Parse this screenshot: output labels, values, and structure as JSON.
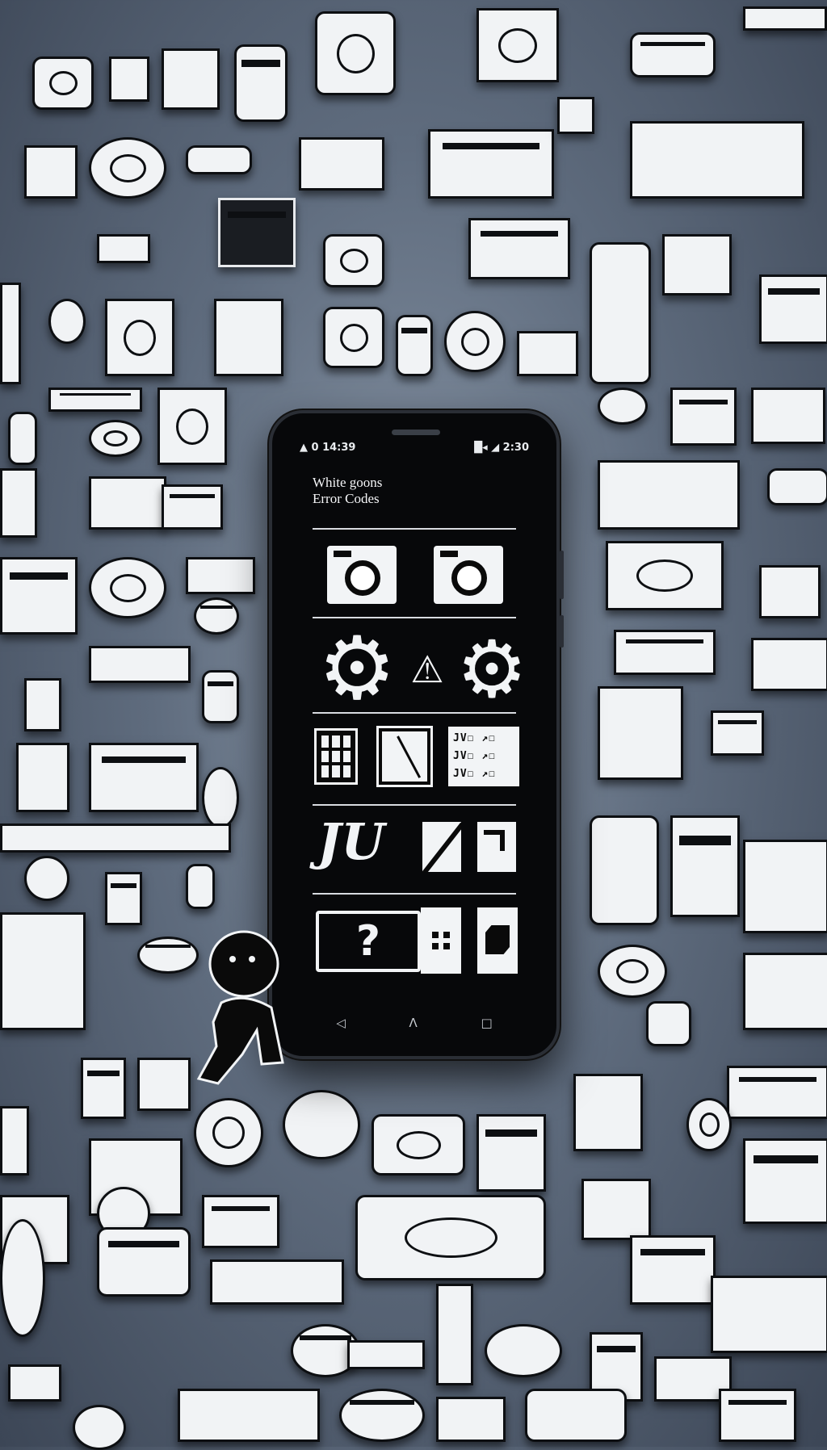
{
  "status_bar": {
    "left": "▲ 0 14:39",
    "right": "█◂ ◢ 2:30"
  },
  "app": {
    "title_line1": "White goons",
    "title_line2": "Error Codes"
  },
  "rows": {
    "appliances": [
      "washing-machine",
      "washing-machine"
    ],
    "settings": [
      "gear",
      "warning",
      "gear"
    ],
    "diagnostics": [
      "keypad-grid",
      "chart-panel",
      "error-code-list"
    ],
    "codes_tile_lines": [
      "JV☐ ↗☐",
      "JV☐ ↗☐",
      "JV☐ ↗☐"
    ],
    "actions_glyph": "JU",
    "help_glyph": "?"
  },
  "nav": {
    "back": "◁",
    "home": "Λ",
    "recents": "□"
  },
  "colors": {
    "background": "#5f6c7e",
    "phone_body": "#07080a",
    "icon_fill": "#f1f3f5",
    "outline": "#0d0f12"
  }
}
